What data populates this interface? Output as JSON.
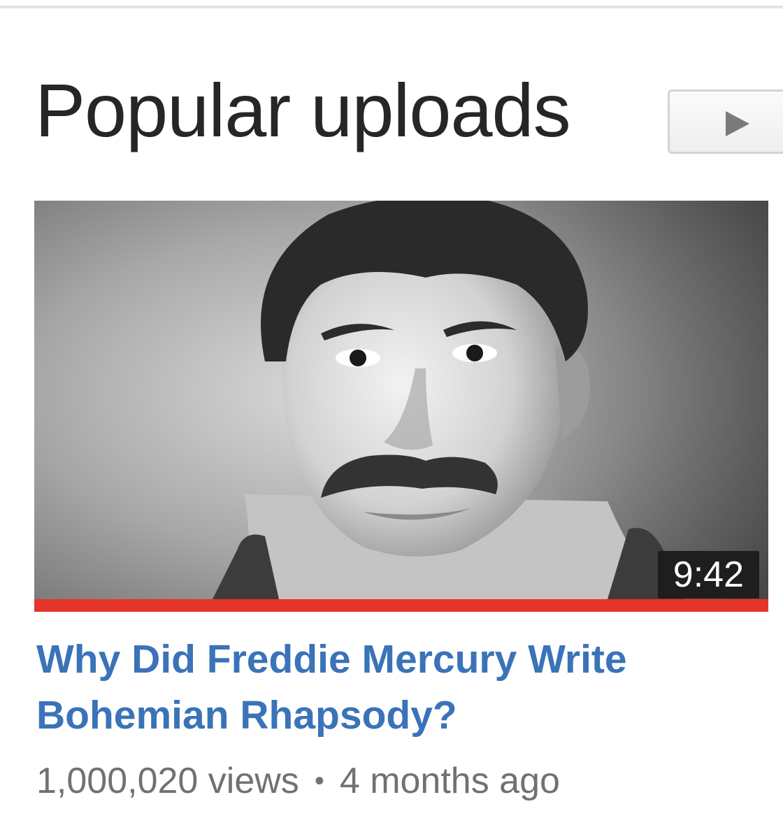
{
  "section": {
    "title": "Popular uploads",
    "play_all_icon": "play-triangle-icon"
  },
  "video": {
    "duration": "9:42",
    "title": "Why Did Freddie Mercury Write Bohemian Rhapsody?",
    "views": "1,000,020 views",
    "separator": "•",
    "age": "4 months ago",
    "watch_progress": 1.0
  },
  "colors": {
    "title_link": "#3a73b8",
    "progress": "#e5352a",
    "heading": "#262626",
    "meta": "#717171"
  }
}
